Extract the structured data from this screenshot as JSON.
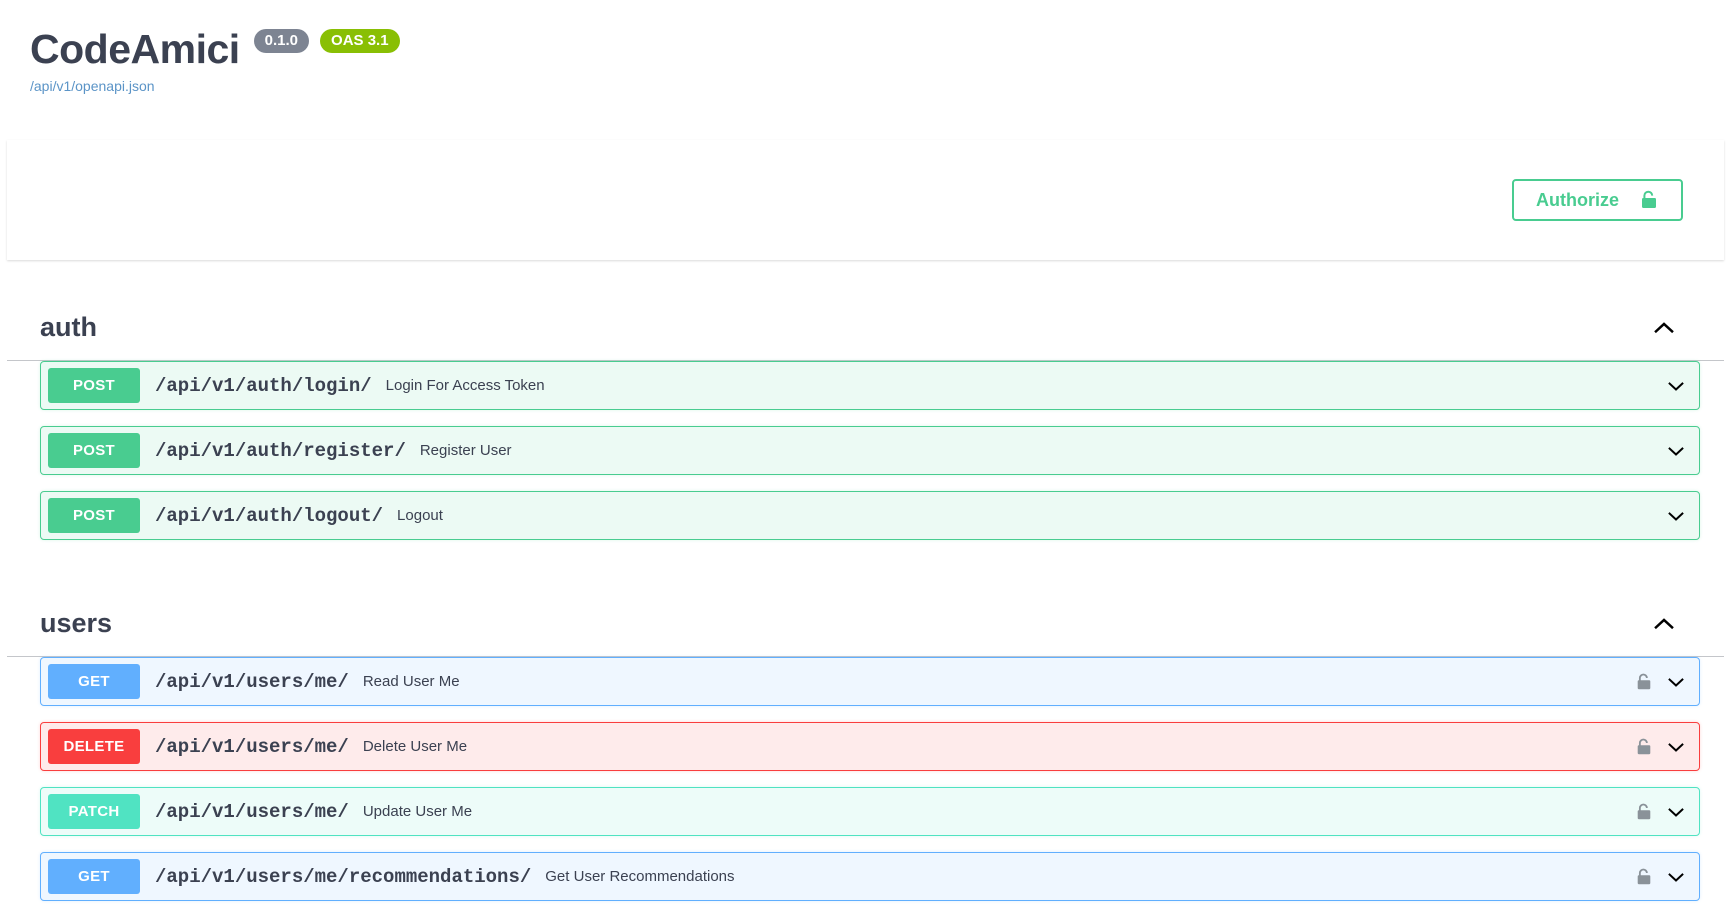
{
  "info": {
    "title": "CodeAmici",
    "version_badge": "0.1.0",
    "oas_badge": "OAS 3.1",
    "spec_url": "/api/v1/openapi.json"
  },
  "scheme": {
    "authorize_label": "Authorize",
    "lock_icon": "unlock-icon"
  },
  "colors": {
    "post": "#49cc90",
    "get": "#61affe",
    "delete": "#f93e3e",
    "patch": "#50e3c2",
    "version_badge_bg": "#7d8492",
    "oas_badge_bg": "#89bf04",
    "link": "#5b94c7",
    "text": "#3b4151"
  },
  "tags": [
    {
      "name": "auth",
      "toggle_icon": "chevron-up-icon",
      "operations": [
        {
          "method": "POST",
          "method_class": "post",
          "path": "/api/v1/auth/login/",
          "summary": "Login For Access Token",
          "locked": false,
          "arrow_icon": "chevron-down-icon"
        },
        {
          "method": "POST",
          "method_class": "post",
          "path": "/api/v1/auth/register/",
          "summary": "Register User",
          "locked": false,
          "arrow_icon": "chevron-down-icon"
        },
        {
          "method": "POST",
          "method_class": "post",
          "path": "/api/v1/auth/logout/",
          "summary": "Logout",
          "locked": false,
          "arrow_icon": "chevron-down-icon"
        }
      ]
    },
    {
      "name": "users",
      "toggle_icon": "chevron-up-icon",
      "operations": [
        {
          "method": "GET",
          "method_class": "get",
          "path": "/api/v1/users/me/",
          "summary": "Read User Me",
          "locked": true,
          "arrow_icon": "chevron-down-icon"
        },
        {
          "method": "DELETE",
          "method_class": "delete",
          "path": "/api/v1/users/me/",
          "summary": "Delete User Me",
          "locked": true,
          "arrow_icon": "chevron-down-icon"
        },
        {
          "method": "PATCH",
          "method_class": "patch",
          "path": "/api/v1/users/me/",
          "summary": "Update User Me",
          "locked": true,
          "arrow_icon": "chevron-down-icon"
        },
        {
          "method": "GET",
          "method_class": "get",
          "path": "/api/v1/users/me/recommendations/",
          "summary": "Get User Recommendations",
          "locked": true,
          "arrow_icon": "chevron-down-icon"
        }
      ]
    }
  ]
}
